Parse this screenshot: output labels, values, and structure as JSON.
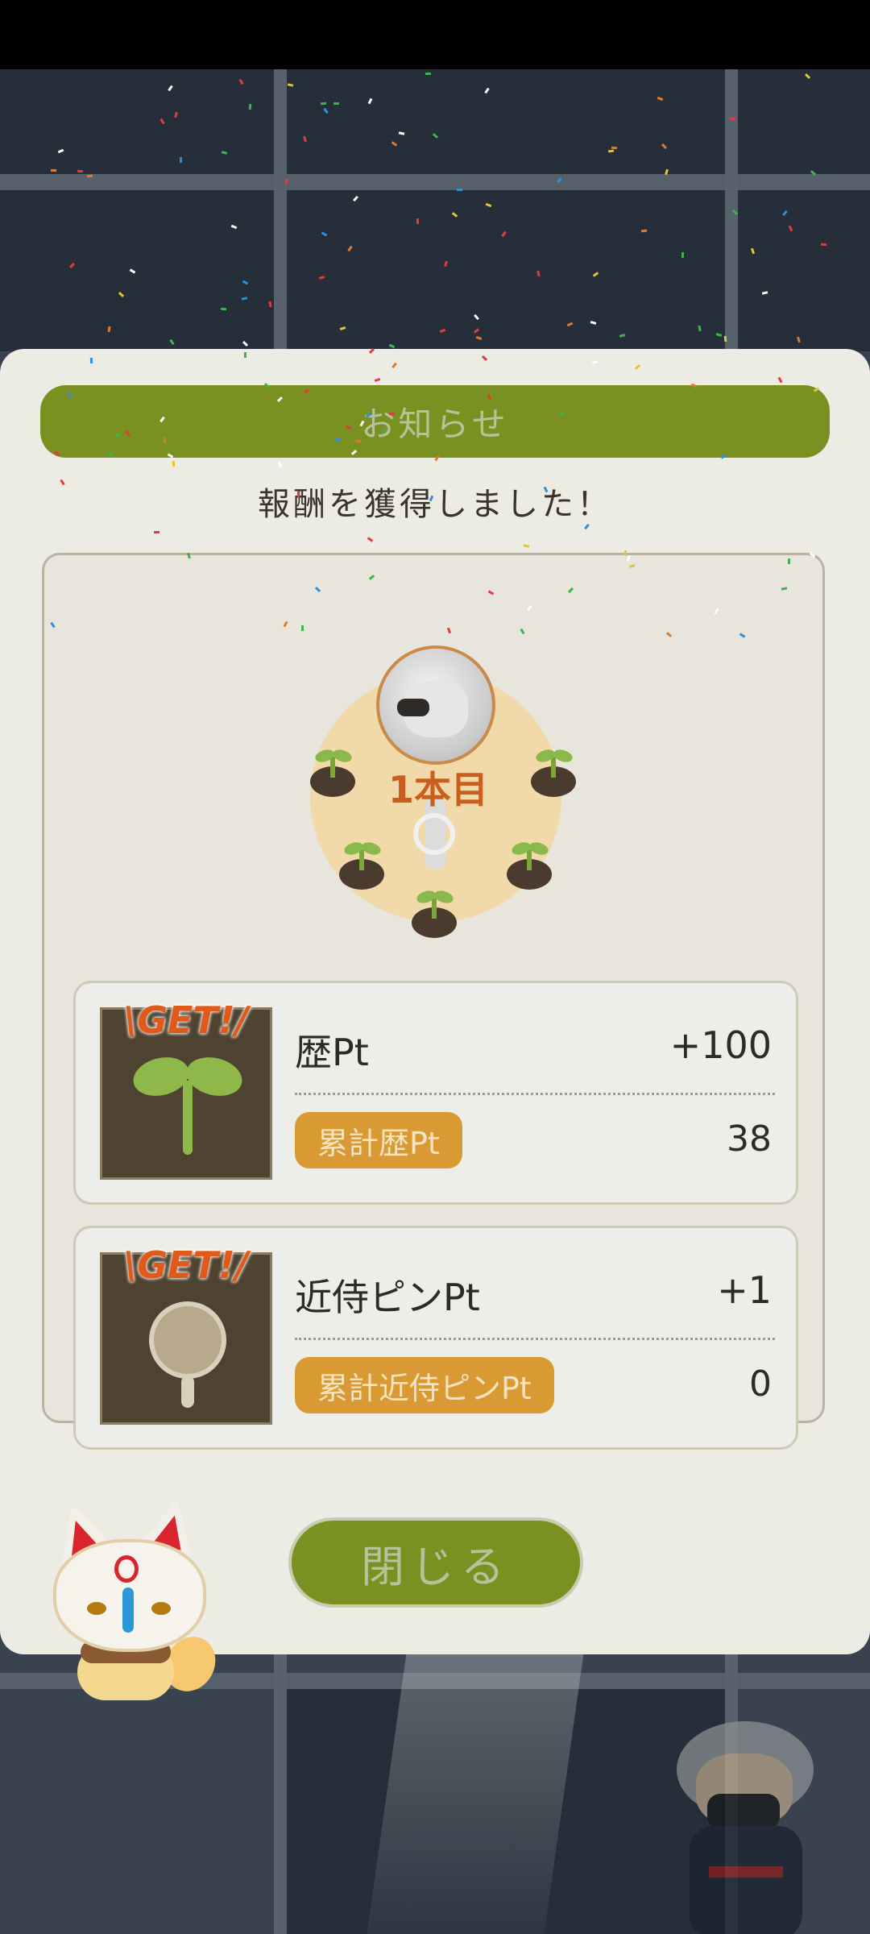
{
  "modal": {
    "title": "お知らせ",
    "subtitle": "報酬を獲得しました！",
    "progress_label": "1本目",
    "rewards": [
      {
        "get_label": "\\GET!/",
        "icon": "sprout-icon",
        "name": "歴Pt",
        "value": "+100",
        "total_label": "累計歴Pt",
        "total_value": "38"
      },
      {
        "get_label": "\\GET!/",
        "icon": "pin-icon",
        "name": "近侍ピンPt",
        "value": "+1",
        "total_label": "累計近侍ピンPt",
        "total_value": "0"
      }
    ],
    "close_label": "閉じる"
  },
  "colors": {
    "header_green": "#7a9021",
    "badge_orange": "#d99a34",
    "get_text": "#e05a1a",
    "ring_fill": "#f1d9a9"
  }
}
